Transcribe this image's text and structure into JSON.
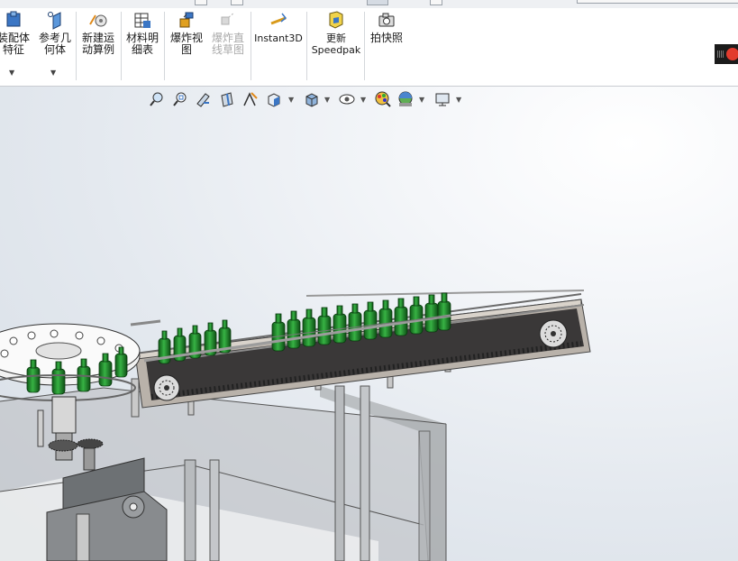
{
  "ribbon": {
    "buttons": [
      {
        "id": "assembly-feature",
        "label": "装配体\n特征",
        "disabled": false
      },
      {
        "id": "reference-geometry",
        "label": "参考几\n何体",
        "disabled": false
      },
      {
        "id": "new-motion-study",
        "label": "新建运\n动算例",
        "disabled": false
      },
      {
        "id": "bill-of-materials",
        "label": "材料明\n细表",
        "disabled": false
      },
      {
        "id": "exploded-view",
        "label": "爆炸视\n图",
        "disabled": false
      },
      {
        "id": "explode-line-sketch",
        "label": "爆炸直\n线草图",
        "disabled": true
      },
      {
        "id": "instant3d",
        "label": "Instant3D",
        "disabled": false
      },
      {
        "id": "update-speedpak",
        "label": "更新\nSpeedpak",
        "disabled": false
      },
      {
        "id": "take-snapshot",
        "label": "拍快照",
        "disabled": false
      }
    ]
  },
  "view_toolbar": {
    "icons": [
      "zoom-to-fit-icon",
      "zoom-to-area-icon",
      "previous-view-icon",
      "section-view-icon",
      "dynamic-annotation-icon",
      "view-orientation-icon",
      "display-style-icon",
      "hide-show-icon",
      "edit-appearance-icon",
      "apply-scene-icon",
      "view-settings-icon"
    ]
  },
  "colors": {
    "bottle_green": "#1f8a2a",
    "frame_gray": "#a9acaf",
    "glass_gray": "#9a9d9f",
    "background_top": "#ffffff",
    "background_bottom": "#d6dde5"
  }
}
